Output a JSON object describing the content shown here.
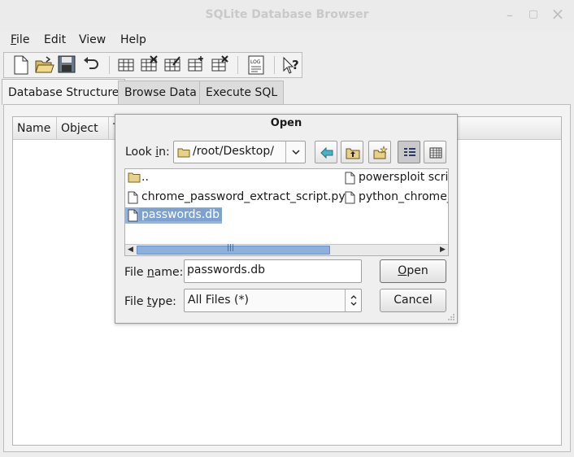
{
  "window": {
    "title": "SQLite Database Browser",
    "minimize_glyph": "–",
    "maximize_glyph": "▢",
    "close_glyph": "×"
  },
  "menu": [
    {
      "label_u": "F",
      "label_rest": "ile"
    },
    {
      "label_u": "",
      "label_rest": "Edit"
    },
    {
      "label_u": "",
      "label_rest": "View"
    },
    {
      "label_u": "",
      "label_rest": "Help"
    }
  ],
  "toolbar_icons": [
    "new-database-icon",
    "open-database-icon",
    "save-icon",
    "undo-icon",
    "create-table-icon",
    "delete-table-icon",
    "modify-table-icon",
    "create-index-icon",
    "delete-index-icon",
    "sql-log-icon",
    "whats-this-icon"
  ],
  "tabs": [
    {
      "label": "Database Structure",
      "active": true
    },
    {
      "label": "Browse Data",
      "active": false
    },
    {
      "label": "Execute SQL",
      "active": false
    }
  ],
  "table": {
    "columns": [
      "Name",
      "Object",
      "T"
    ]
  },
  "dialog": {
    "title": "Open",
    "look_in_label_pre": "Look ",
    "look_in_label_u": "i",
    "look_in_label_post": "n:",
    "look_in_value": "/root/Desktop/",
    "files": [
      {
        "name": "..",
        "type": "folder"
      },
      {
        "name": "chrome_password_extract_script.py",
        "type": "file"
      },
      {
        "name": "passwords.db",
        "type": "file",
        "selected": true
      },
      {
        "name": "powersploit scrip",
        "type": "file"
      },
      {
        "name": "python_chrome_",
        "type": "file"
      }
    ],
    "file_name_label_pre": "File ",
    "file_name_label_u": "n",
    "file_name_label_post": "ame:",
    "file_name_value": "passwords.db",
    "file_type_label_pre": "File ",
    "file_type_label_u": "t",
    "file_type_label_post": "ype:",
    "file_type_value": "All Files (*)",
    "open_label_u": "O",
    "open_label_rest": "pen",
    "cancel_label": "Cancel",
    "scroll_grip": "|||"
  }
}
